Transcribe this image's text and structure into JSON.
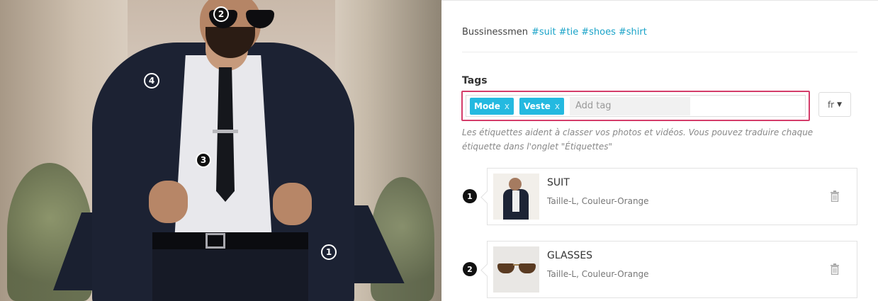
{
  "photo": {
    "markers": [
      {
        "label": "2",
        "style": "dark"
      },
      {
        "label": "4",
        "style": "light"
      },
      {
        "label": "3",
        "style": "dark"
      },
      {
        "label": "1",
        "style": "light"
      }
    ]
  },
  "caption": {
    "text": "Bussinessmen",
    "hashtags": [
      "#suit",
      "#tie",
      "#shoes",
      "#shirt"
    ]
  },
  "tags": {
    "label": "Tags",
    "chips": [
      {
        "label": "Mode",
        "remove": "x"
      },
      {
        "label": "Veste",
        "remove": "x"
      }
    ],
    "input_placeholder": "Add tag",
    "language": "fr",
    "help_text": "Les étiquettes aident à classer vos photos et vidéos. Vous pouvez traduire chaque étiquette dans l'onglet \"Étiquettes\""
  },
  "products": [
    {
      "marker": "1",
      "title": "SUIT",
      "subtitle": "Taille-L, Couleur-Orange",
      "thumb_icon": "suit-photo"
    },
    {
      "marker": "2",
      "title": "GLASSES",
      "subtitle": "Taille-L, Couleur-Orange",
      "thumb_icon": "glasses-photo"
    }
  ],
  "colors": {
    "accent": "#24b9e0",
    "highlight_border": "#d43d6a",
    "hashtag": "#1aa3c8"
  }
}
